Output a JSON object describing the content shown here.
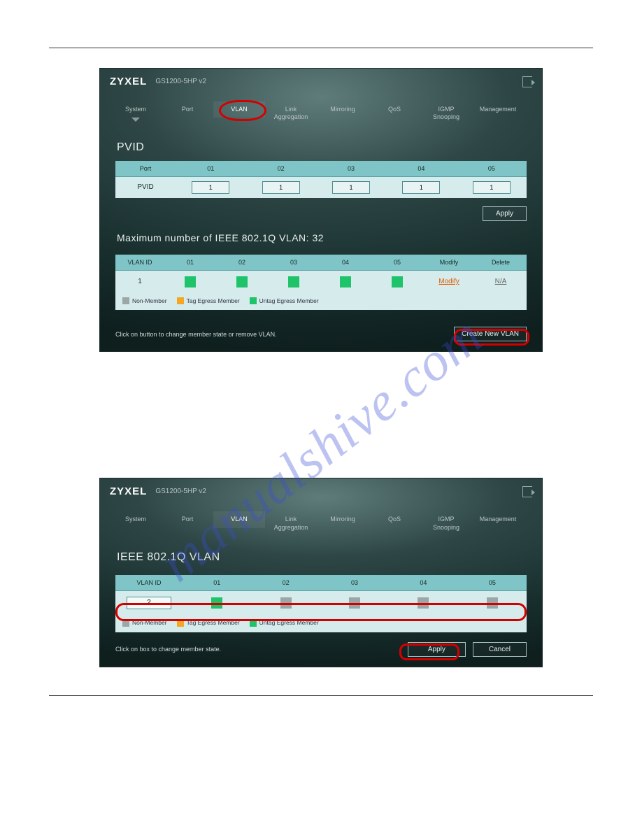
{
  "brand": "ZYXEL",
  "model": "GS1200-5HP v2",
  "navTabs": [
    "System",
    "Port",
    "VLAN",
    "Link\nAggregation",
    "Mirroring",
    "QoS",
    "IGMP\nSnooping",
    "Management"
  ],
  "pvid": {
    "title": "PVID",
    "portHeader": "Port",
    "rowLabel": "PVID",
    "cols": [
      "01",
      "02",
      "03",
      "04",
      "05"
    ],
    "values": [
      "1",
      "1",
      "1",
      "1",
      "1"
    ],
    "applyLabel": "Apply"
  },
  "vlanMaxTitle": "Maximum number of IEEE 802.1Q VLAN: 32",
  "vlanTable": {
    "headers": [
      "VLAN ID",
      "01",
      "02",
      "03",
      "04",
      "05",
      "Modify",
      "Delete"
    ],
    "row": {
      "id": "1",
      "ports": [
        "g",
        "g",
        "g",
        "g",
        "g"
      ],
      "modifyLabel": "Modify",
      "deleteLabel": "N/A"
    }
  },
  "legend": {
    "non": "Non-Member",
    "tag": "Tag Egress Member",
    "untag": "Untag Egress Member"
  },
  "footer1": {
    "hint": "Click on button to change member state or remove VLAN.",
    "create": "Create New VLAN"
  },
  "panel2": {
    "title": "IEEE 802.1Q VLAN",
    "headers": [
      "VLAN ID",
      "01",
      "02",
      "03",
      "04",
      "05"
    ],
    "vid": "2",
    "ports": [
      "g",
      "gray",
      "gray",
      "gray",
      "gray"
    ],
    "hint": "Click on box to change member state.",
    "apply": "Apply",
    "cancel": "Cancel"
  },
  "watermark": "manualshive.com"
}
